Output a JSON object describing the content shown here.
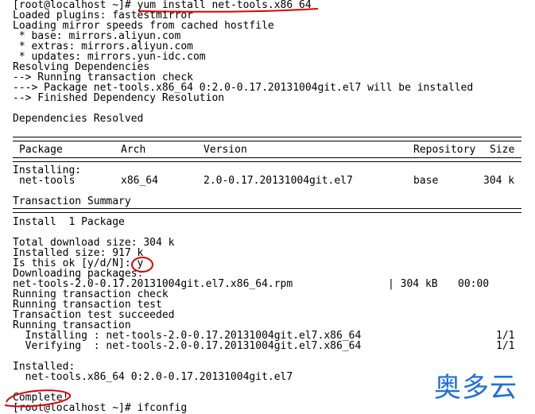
{
  "terminal": {
    "prompt": "[root@localhost ~]# ",
    "command": "yum install net-tools.x86_64",
    "lines_top": [
      "Loaded plugins: fastestmirror",
      "Loading mirror speeds from cached hostfile",
      " * base: mirrors.aliyun.com",
      " * extras: mirrors.aliyun.com",
      " * updates: mirrors.yun-idc.com",
      "Resolving Dependencies",
      "--> Running transaction check",
      "---> Package net-tools.x86_64 0:2.0-0.17.20131004git.el7 will be installed",
      "--> Finished Dependency Resolution",
      "",
      "Dependencies Resolved"
    ],
    "table": {
      "headers": {
        "package": "Package",
        "arch": "Arch",
        "version": "Version",
        "repository": "Repository",
        "size": "Size"
      },
      "section_label": "Installing:",
      "row": {
        "package": "net-tools",
        "arch": "x86_64",
        "version": "2.0-0.17.20131004git.el7",
        "repository": "base",
        "size": "304 k"
      }
    },
    "summary_title": "Transaction Summary",
    "install_count": "Install  1 Package",
    "total_download": "Total download size: 304 k",
    "installed_size": "Installed size: 917 k",
    "confirm_prompt": "Is this ok [y/d/N]: ",
    "confirm_answer": "y",
    "downloading": "Downloading packages:",
    "rpm": {
      "file": "net-tools-2.0-0.17.20131004git.el7.x86_64.rpm",
      "size": "| 304 kB",
      "time": "00:00"
    },
    "running_check": "Running transaction check",
    "running_test": "Running transaction test",
    "test_succeeded": "Transaction test succeeded",
    "running_transaction": "Running transaction",
    "installing_line": "  Installing : net-tools-2.0-0.17.20131004git.el7.x86_64",
    "installing_progress": "1/1",
    "verifying_line": "  Verifying  : net-tools-2.0-0.17.20131004git.el7.x86_64",
    "verifying_progress": "1/1",
    "installed_label": "Installed:",
    "installed_pkg": "  net-tools.x86_64 0:2.0-0.17.20131004git.el7",
    "complete": "Complete!",
    "cutoff_line": "[root@localhost ~]# ifconfig"
  },
  "brand": {
    "text": "奥多云",
    "color": "#1e6fd9"
  },
  "annotation_color": "#e00000"
}
